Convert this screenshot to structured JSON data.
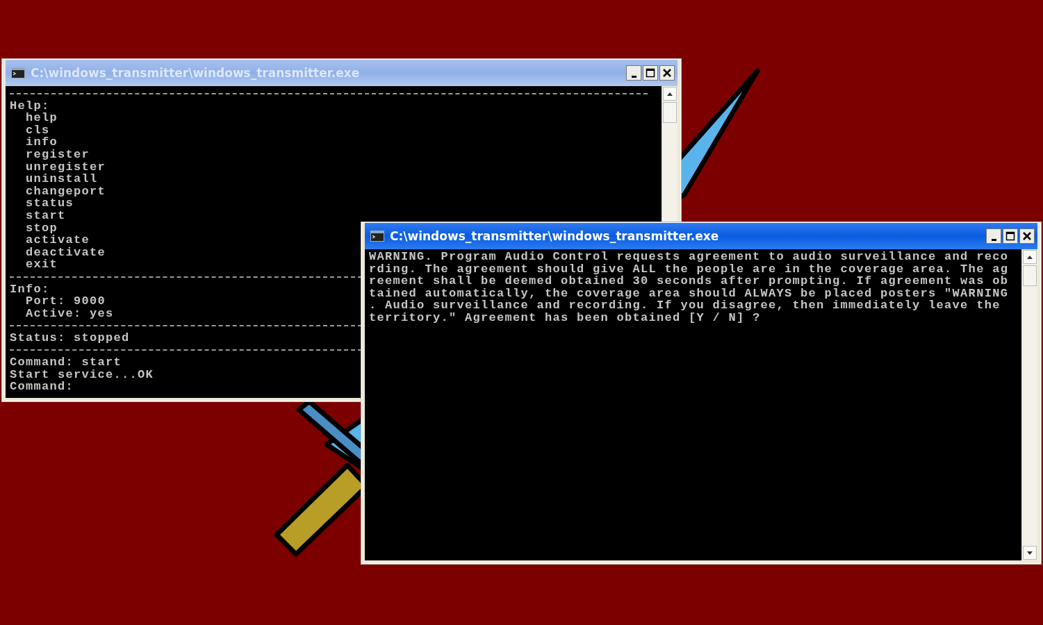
{
  "windows": [
    {
      "title": "C:\\windows_transmitter\\windows_transmitter.exe",
      "active": false,
      "lines": [
        {
          "kind": "rule"
        },
        {
          "kind": "text",
          "text": "Help:"
        },
        {
          "kind": "text",
          "text": "  help"
        },
        {
          "kind": "text",
          "text": "  cls"
        },
        {
          "kind": "text",
          "text": "  info"
        },
        {
          "kind": "text",
          "text": "  register"
        },
        {
          "kind": "text",
          "text": "  unregister"
        },
        {
          "kind": "text",
          "text": "  uninstall"
        },
        {
          "kind": "text",
          "text": "  changeport"
        },
        {
          "kind": "text",
          "text": "  status"
        },
        {
          "kind": "text",
          "text": "  start"
        },
        {
          "kind": "text",
          "text": "  stop"
        },
        {
          "kind": "text",
          "text": "  activate"
        },
        {
          "kind": "text",
          "text": "  deactivate"
        },
        {
          "kind": "text",
          "text": "  exit"
        },
        {
          "kind": "rule"
        },
        {
          "kind": "text",
          "text": "Info:"
        },
        {
          "kind": "text",
          "text": "  Port: 9000"
        },
        {
          "kind": "text",
          "text": "  Active: yes"
        },
        {
          "kind": "rule"
        },
        {
          "kind": "text",
          "text": "Status: stopped"
        },
        {
          "kind": "rule"
        },
        {
          "kind": "text",
          "text": "Command: start"
        },
        {
          "kind": "text",
          "text": "Start service...OK"
        },
        {
          "kind": "text",
          "text": "Command:"
        }
      ]
    },
    {
      "title": "C:\\windows_transmitter\\windows_transmitter.exe",
      "active": true,
      "lines": [
        {
          "kind": "text",
          "text": "WARNING. Program Audio Control requests agreement to audio surveillance and reco"
        },
        {
          "kind": "text",
          "text": "rding. The agreement should give ALL the people are in the coverage area. The ag"
        },
        {
          "kind": "text",
          "text": "reement shall be deemed obtained 30 seconds after prompting. If agreement was ob"
        },
        {
          "kind": "text",
          "text": "tained automatically, the coverage area should ALWAYS be placed posters \"WARNING"
        },
        {
          "kind": "text",
          "text": ". Audio surveillance and recording. If you disagree, then immediately leave the"
        },
        {
          "kind": "text",
          "text": "territory.\" Agreement has been obtained [Y / N] ?"
        }
      ]
    }
  ]
}
